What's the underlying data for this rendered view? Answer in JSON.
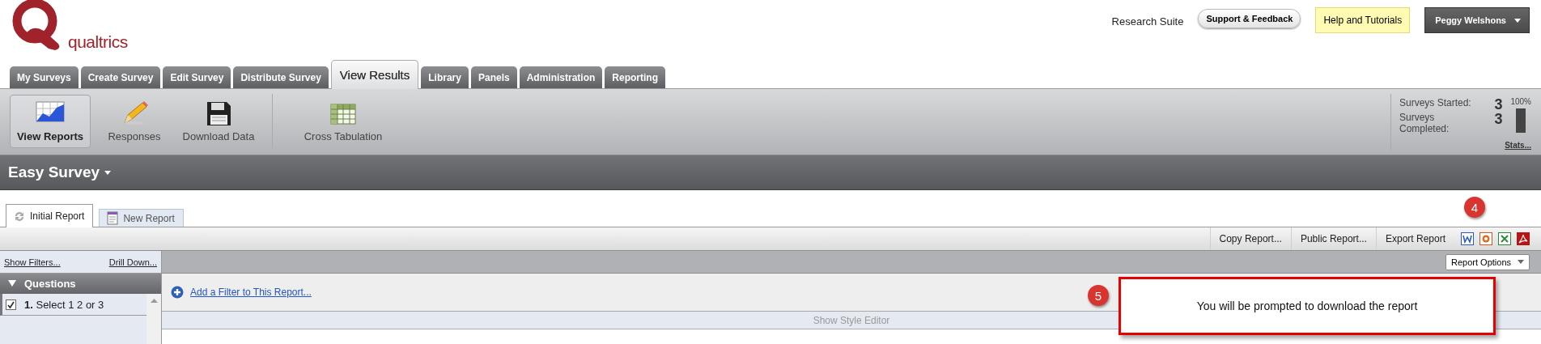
{
  "logo": {
    "wordmark": "qualtrics"
  },
  "header": {
    "suite": "Research Suite",
    "support_button": "Support & Feedback",
    "help_button": "Help and Tutorials",
    "user_menu": "Peggy Welshons"
  },
  "tabs": [
    {
      "label": "My Surveys",
      "selected": false
    },
    {
      "label": "Create Survey",
      "selected": false
    },
    {
      "label": "Edit Survey",
      "selected": false
    },
    {
      "label": "Distribute Survey",
      "selected": false
    },
    {
      "label": "View Results",
      "selected": true
    },
    {
      "label": "Library",
      "selected": false
    },
    {
      "label": "Panels",
      "selected": false
    },
    {
      "label": "Administration",
      "selected": false
    },
    {
      "label": "Reporting",
      "selected": false
    }
  ],
  "toolbar": {
    "groups": [
      [
        {
          "label": "View Reports",
          "kind": "chart",
          "selected": true
        },
        {
          "label": "Responses",
          "kind": "pencil",
          "selected": false
        },
        {
          "label": "Download Data",
          "kind": "disk",
          "selected": false
        }
      ],
      [
        {
          "label": "Cross Tabulation",
          "kind": "table",
          "selected": false
        }
      ]
    ]
  },
  "stats": {
    "rows": [
      {
        "label": "Surveys Started:",
        "value": "3"
      },
      {
        "label": "Surveys Completed:",
        "value": "3"
      }
    ],
    "percent": "100%",
    "level": 1,
    "link": "Stats..."
  },
  "survey": {
    "title": "Easy Survey"
  },
  "report_tabs": [
    {
      "label": "Initial Report",
      "kind": "refresh",
      "selected": true
    },
    {
      "label": "New Report",
      "kind": "document",
      "selected": false
    }
  ],
  "report_actions": [
    "Copy Report...",
    "Public Report...",
    "Export Report"
  ],
  "export_formats": [
    {
      "kind": "word"
    },
    {
      "kind": "slides"
    },
    {
      "kind": "spreadsheet"
    },
    {
      "kind": "pdf"
    }
  ],
  "sidebar": {
    "show_filters": "Show Filters...",
    "drill_down": "Drill Down...",
    "section": {
      "title": "Questions",
      "expanded": true
    },
    "questions": [
      {
        "text": "**1.** Select 1 2 or 3",
        "checked": true
      }
    ]
  },
  "report_options": "Report Options",
  "add_filter": "Add a Filter to This Report...",
  "style_editor": "Show Style Editor",
  "callouts": [
    {
      "number": "4"
    },
    {
      "number": "5",
      "text": "You will be prompted to download the report"
    }
  ]
}
